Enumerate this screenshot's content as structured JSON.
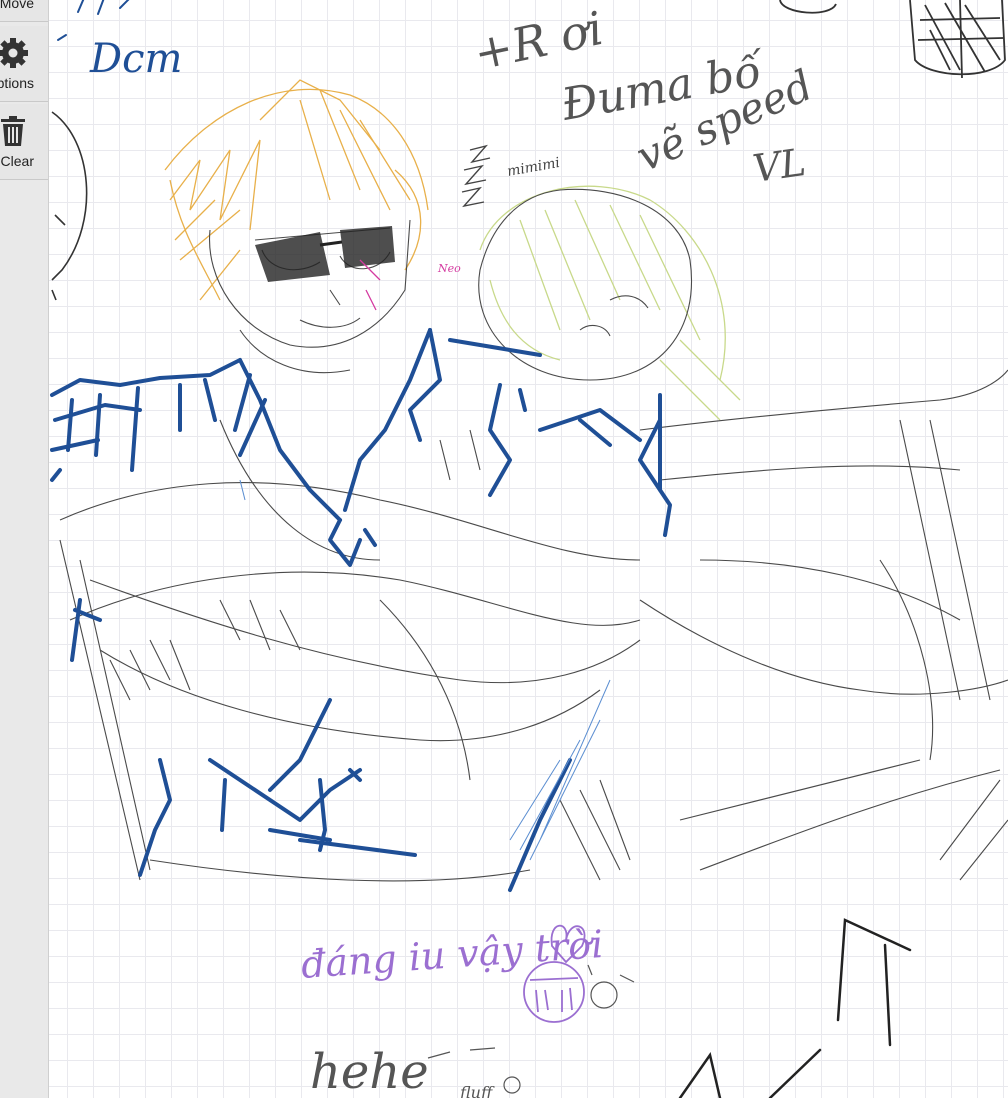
{
  "toolbar": {
    "buttons": [
      {
        "label": "Move",
        "icon": "move-icon"
      },
      {
        "label": "Options",
        "icon": "gear-icon"
      },
      {
        "label": "Clear",
        "icon": "trash-icon"
      }
    ]
  },
  "canvas": {
    "texts": [
      {
        "id": "blue-top-left",
        "text": "Dcm",
        "color": "#1f4f96"
      },
      {
        "id": "pencil-top-1",
        "text": "+R ơi",
        "color": "#555555"
      },
      {
        "id": "pencil-top-2",
        "text": "Đuma bố",
        "color": "#555555"
      },
      {
        "id": "pencil-top-3",
        "text": "vẽ speed",
        "color": "#555555"
      },
      {
        "id": "pencil-top-4",
        "text": "VL",
        "color": "#555555"
      },
      {
        "id": "mimimi",
        "text": "mimimi",
        "color": "#444444"
      },
      {
        "id": "pink-note",
        "text": "Neo",
        "color": "#d43aa0"
      },
      {
        "id": "purple-note",
        "text": "đáng iu vậy trời",
        "color": "#9b6fd1"
      },
      {
        "id": "bottom-hehe",
        "text": "hehe",
        "color": "#555555"
      },
      {
        "id": "bottom-fluff",
        "text": "fluff",
        "color": "#555555"
      }
    ]
  },
  "colors": {
    "ink_blue": "#1f4f96",
    "pencil_grey": "#555555",
    "hair_orange": "#e8b04a",
    "hair_green": "#c8d98a",
    "purple": "#9b6fd1",
    "pink": "#d43aa0",
    "toolbar_bg": "#e9e9e9"
  }
}
